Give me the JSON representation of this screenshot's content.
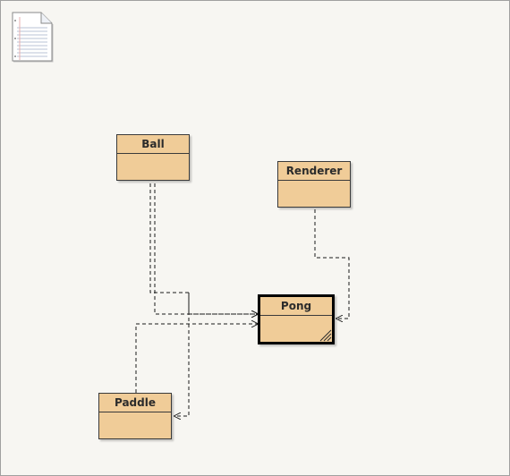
{
  "diagram": {
    "classes": [
      {
        "id": "ball",
        "name": "Ball"
      },
      {
        "id": "renderer",
        "name": "Renderer"
      },
      {
        "id": "pong",
        "name": "Pong"
      },
      {
        "id": "paddle",
        "name": "Paddle"
      }
    ],
    "selected": "Pong",
    "colors": {
      "class_fill": "#f0cc98",
      "class_border": "#3a3a3a",
      "canvas_bg": "#f7f6f2",
      "connector": "#1a1a1a"
    },
    "icons": [
      "document-icon",
      "resize-grip-icon"
    ]
  }
}
